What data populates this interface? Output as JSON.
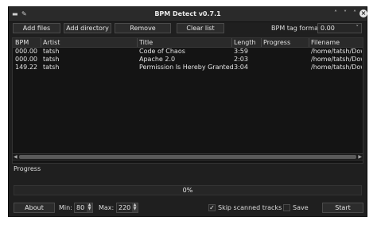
{
  "window": {
    "title": "BPM Detect v0.7.1"
  },
  "toolbar": {
    "add_files": "Add files",
    "add_directory": "Add directory",
    "remove": "Remove",
    "clear_list": "Clear list",
    "bpm_tag_format_label": "BPM tag format:",
    "bpm_tag_format_value": "0.00"
  },
  "table": {
    "columns": [
      "BPM",
      "Artist",
      "Title",
      "Length",
      "Progress",
      "Filename"
    ],
    "rows": [
      {
        "bpm": "000.00",
        "artist": "tatsh",
        "title": "Code of Chaos",
        "length": "3:59",
        "progress": "",
        "filename": "/home/tatsh/Downlo"
      },
      {
        "bpm": "000.00",
        "artist": "tatsh",
        "title": "Apache 2.0",
        "length": "2:03",
        "progress": "",
        "filename": "/home/tatsh/Downlo"
      },
      {
        "bpm": "149.22",
        "artist": "tatsh",
        "title": "Permission Is Hereby Granted",
        "length": "3:04",
        "progress": "",
        "filename": "/home/tatsh/Downlo"
      }
    ]
  },
  "progress": {
    "label": "Progress",
    "text": "0%",
    "fraction": 0
  },
  "bottom": {
    "about": "About",
    "min_label": "Min:",
    "min_value": "80",
    "max_label": "Max:",
    "max_value": "220",
    "skip_scanned_label": "Skip scanned tracks",
    "skip_scanned_checked": true,
    "save_label": "Save",
    "save_checked": false,
    "start": "Start"
  }
}
